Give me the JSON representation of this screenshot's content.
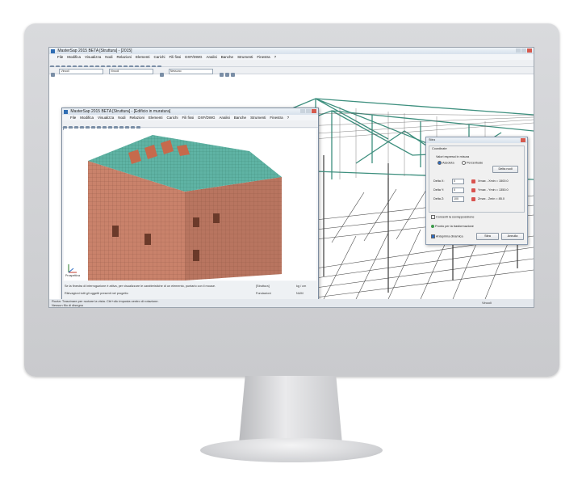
{
  "main_window": {
    "title": "MasterSap 2015 BETA [Struttura] - [2015]",
    "menu": [
      "File",
      "Modifica",
      "Visualizza",
      "Nodi",
      "Relazioni",
      "Elementi",
      "Carichi",
      "Fili fissi",
      "DXF/DWG",
      "Analisi",
      "Banche",
      "Strumenti",
      "Finestra",
      "?"
    ],
    "combo_1": "Vincoli",
    "combo_2": "Vincoli",
    "combo_3": "Nessuno",
    "status_left": "Ruota: Trascinare per ruotare la vista. Ctrl+clic imposta centro di rotazione.",
    "status_left_2": "Nessun filo di disegno",
    "status_right": "Vincoli"
  },
  "inner_window": {
    "title": "MasterSap 2015 BETA [Struttura] - [Edificio in muratura]",
    "menu": [
      "File",
      "Modifica",
      "Visualizza",
      "Nodi",
      "Relazioni",
      "Elementi",
      "Carichi",
      "Fili fissi",
      "DXF/DWG",
      "Analisi",
      "Banche",
      "Strumenti",
      "Finestra",
      "?"
    ],
    "status_line_1": "Se la finestra di interrogazione è attiva, per visualizzare le caratteristiche di un elemento, puntarlo con il mouse.",
    "status_line_2": "Rilevagioni tutti gli oggetti presenti nel progetto",
    "status_field_1": "[Struttura]",
    "status_field_2": "kg / cm",
    "status_field_3": "Fondazioni",
    "status_field_4": "NUM",
    "view_label": "Prospettiva"
  },
  "dialog": {
    "title": "Stira",
    "group_title": "Coordinate",
    "values_label": "Valori espressi in misura",
    "radio_absolute": "Assoluta",
    "radio_percent": "Percentuale",
    "nodes_button": "Delta nodi",
    "rows": [
      {
        "label": "Delta X:",
        "value": "0",
        "result": "Xmax - Xmin = 1500.0"
      },
      {
        "label": "Delta Y:",
        "value": "0",
        "result": "Ymax - Ymin = 1350.0"
      },
      {
        "label": "Delta Z:",
        "value": "100",
        "result": "Zmax - Zmin = 85.0"
      }
    ],
    "overlap_label": "Consenti la sovrapposizione",
    "ready_label": "Pronto per la trasformazione",
    "preview_label": "Anteprima dinamica",
    "ok_button": "Stira",
    "cancel_button": "Annulla"
  },
  "colors": {
    "roof_teal": "#5fb3a4",
    "wall_brick": "#c9826b",
    "frame_gray": "#4a4a4a",
    "frame_teal": "#3d8f7e"
  }
}
